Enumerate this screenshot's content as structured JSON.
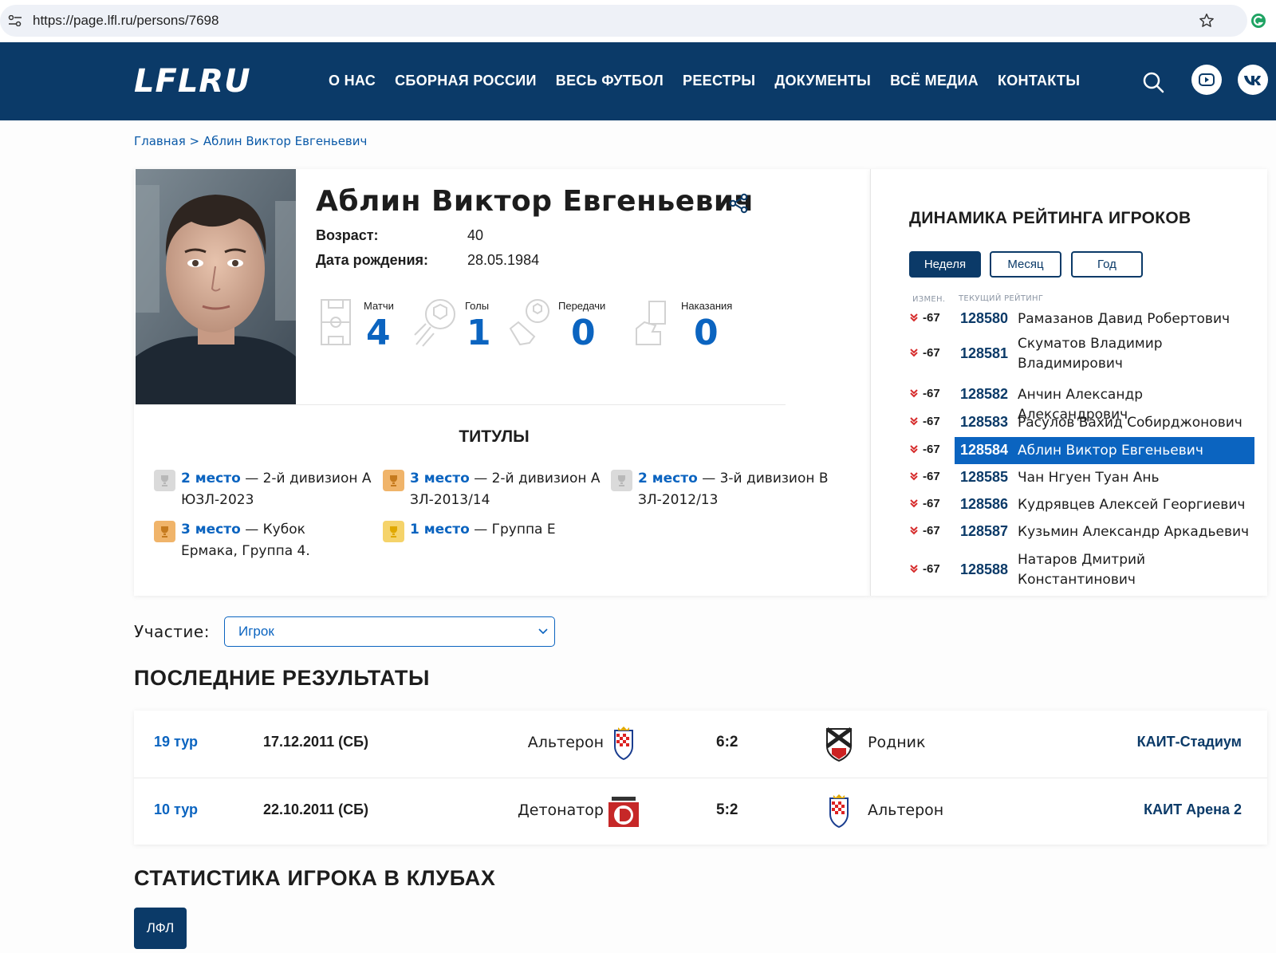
{
  "browser": {
    "url": "https://page.lfl.ru/persons/7698"
  },
  "header": {
    "logo": "LFLRU",
    "nav": [
      "О НАС",
      "СБОРНАЯ РОССИИ",
      "ВЕСЬ ФУТБОЛ",
      "РЕЕСТРЫ",
      "ДОКУМЕНТЫ",
      "ВСЁ МЕДИА",
      "КОНТАКТЫ"
    ]
  },
  "breadcrumb": "Главная > Аблин Виктор Евгеньевич",
  "player": {
    "name": "Аблин Виктор Евгеньевич",
    "age_label": "Возраст:",
    "age": "40",
    "birth_label": "Дата рождения:",
    "birth_date": "28.05.1984",
    "stats": [
      {
        "label": "Матчи",
        "value": "4",
        "icon": "field-icon"
      },
      {
        "label": "Голы",
        "value": "1",
        "icon": "ball-goal-icon"
      },
      {
        "label": "Передачи",
        "value": "0",
        "icon": "boot-ball-icon"
      },
      {
        "label": "Наказания",
        "value": "0",
        "icon": "card-hand-icon"
      }
    ]
  },
  "titles": {
    "heading": "ТИТУЛЫ",
    "items": [
      {
        "place": "2 место",
        "text": "— 2-й дивизион А ЮЗЛ-2023",
        "trophy": "silver"
      },
      {
        "place": "3 место",
        "text": "— 2-й дивизион А ЗЛ-2013/14",
        "trophy": "bronze"
      },
      {
        "place": "2 место",
        "text": "— 3-й дивизион В ЗЛ-2012/13",
        "trophy": "silver"
      },
      {
        "place": "3 место",
        "text": "— Кубок Ермака, Группа 4.",
        "trophy": "bronze"
      },
      {
        "place": "1 место",
        "text": "— Группа Е",
        "trophy": "gold"
      }
    ]
  },
  "rating": {
    "title": "ДИНАМИКА РЕЙТИНГА ИГРОКОВ",
    "periods": [
      "Неделя",
      "Месяц",
      "Год"
    ],
    "active_period": "Неделя",
    "col_change": "ИЗМЕН.",
    "col_current": "ТЕКУЩИЙ РЕЙТИНГ",
    "rows": [
      {
        "change": "-67",
        "rank": "128580",
        "name": "Рамазанов Давид Робертович"
      },
      {
        "change": "-67",
        "rank": "128581",
        "name": "Скуматов Владимир Владимирович"
      },
      {
        "change": "-67",
        "rank": "128582",
        "name": "Анчин Александр Александрович"
      },
      {
        "change": "-67",
        "rank": "128583",
        "name": "Расулов Вахид Собирджонович"
      },
      {
        "change": "-67",
        "rank": "128584",
        "name": "Аблин Виктор Евгеньевич"
      },
      {
        "change": "-67",
        "rank": "128585",
        "name": "Чан Нгуен Туан Ань"
      },
      {
        "change": "-67",
        "rank": "128586",
        "name": "Кудрявцев Алексей Георгиевич"
      },
      {
        "change": "-67",
        "rank": "128587",
        "name": "Кузьмин Александр Аркадьевич"
      },
      {
        "change": "-67",
        "rank": "128588",
        "name": "Натаров Дмитрий Константинович"
      }
    ],
    "highlighted_rank": "128584"
  },
  "participation": {
    "label": "Участие:",
    "value": "Игрок"
  },
  "results": {
    "heading": "ПОСЛЕДНИЕ РЕЗУЛЬТАТЫ",
    "rows": [
      {
        "round": "19 тур",
        "date": "17.12.2011 (СБ)",
        "home": "Альтерон",
        "score": "6:2",
        "away": "Родник",
        "venue": "КАИТ-Стадиум"
      },
      {
        "round": "10 тур",
        "date": "22.10.2011 (СБ)",
        "home": "Детонатор",
        "score": "5:2",
        "away": "Альтерон",
        "venue": "КАИТ Арена 2"
      }
    ]
  },
  "clubs": {
    "heading": "СТАТИСТИКА ИГРОКА В КЛУБАХ",
    "tab": "ЛФЛ"
  },
  "colors": {
    "brand_navy": "#0b3a68",
    "accent_blue": "#0b64c0",
    "down_red": "#d62b2b",
    "gold": "#f5d36a",
    "silver": "#dadada",
    "bronze": "#f0b46a"
  }
}
